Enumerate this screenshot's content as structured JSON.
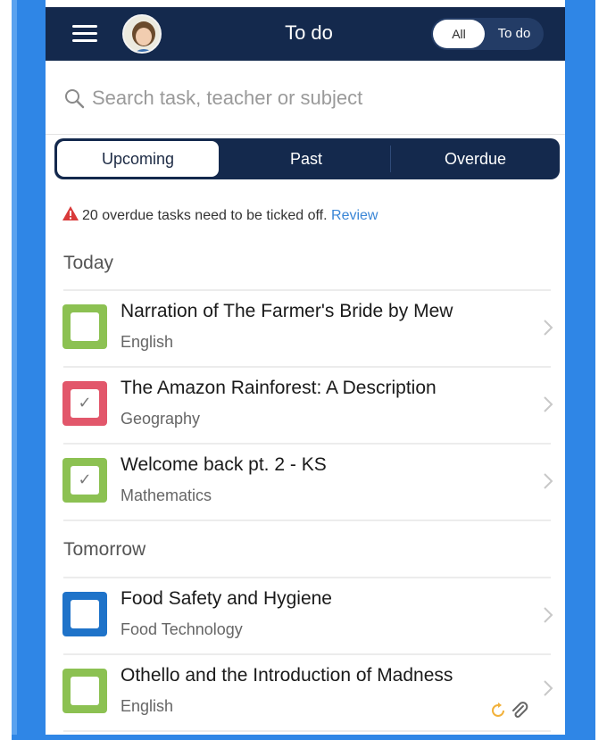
{
  "header": {
    "title": "To do",
    "toggle": {
      "all_label": "All",
      "todo_label": "To do"
    }
  },
  "search": {
    "placeholder": "Search task, teacher or subject"
  },
  "tabs": [
    {
      "label": "Upcoming",
      "active": true
    },
    {
      "label": "Past",
      "active": false
    },
    {
      "label": "Overdue",
      "active": false
    }
  ],
  "alert": {
    "text": "20 overdue tasks need to be ticked off.",
    "link": "Review"
  },
  "sections": [
    {
      "heading": "Today",
      "tasks": [
        {
          "title": "Narration of The Farmer's Bride by Mew",
          "subject": "English",
          "color": "#8cc152",
          "checked": false
        },
        {
          "title": "The Amazon Rainforest: A Description",
          "subject": "Geography",
          "color": "#e2576b",
          "checked": true
        },
        {
          "title": "Welcome back pt. 2 - KS",
          "subject": "Mathematics",
          "color": "#8cc152",
          "checked": true
        }
      ]
    },
    {
      "heading": "Tomorrow",
      "tasks": [
        {
          "title": "Food Safety and Hygiene",
          "subject": "Food Technology",
          "color": "#1f73c9",
          "checked": false
        },
        {
          "title": "Othello and the Introduction of Madness",
          "subject": "English",
          "color": "#8cc152",
          "checked": false,
          "icons": [
            "refresh-icon",
            "paperclip-icon"
          ]
        }
      ]
    }
  ],
  "colors": {
    "header_bg": "#14294d",
    "frame": "#2f86e6",
    "link": "#3a86d6",
    "alert": "#d93a3a"
  },
  "icons": {
    "menu": "hamburger-icon",
    "search": "search-icon",
    "alert": "warning-icon",
    "chevron": "chevron-right-icon",
    "check": "✓"
  }
}
